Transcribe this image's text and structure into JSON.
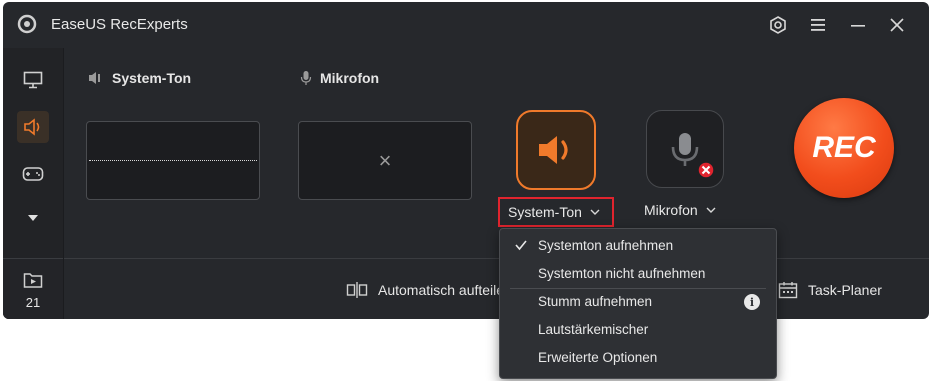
{
  "app": {
    "title": "EaseUS RecExperts"
  },
  "sidebar": {
    "folder_count": "21"
  },
  "sections": {
    "system_audio_label": "System-Ton",
    "microphone_label": "Mikrofon"
  },
  "mic_panel": {
    "placeholder": "×"
  },
  "buttons": {
    "system_audio": "System-Ton",
    "microphone": "Mikrofon",
    "rec": "REC"
  },
  "bottombar": {
    "auto_split": "Automatisch aufteilen",
    "task_planner": "Task-Planer"
  },
  "dropdown": {
    "items": [
      {
        "label": "Systemton aufnehmen",
        "checked": true
      },
      {
        "label": "Systemton nicht aufnehmen"
      },
      {
        "label": "Stumm aufnehmen",
        "info": "i"
      },
      {
        "label": "Lautstärkemischer"
      },
      {
        "label": "Erweiterte Optionen"
      }
    ]
  },
  "colors": {
    "accent": "#f07a2b",
    "rec": "#f24d1c",
    "highlight_border": "#e0242e",
    "mic_error": "#e0242e"
  }
}
